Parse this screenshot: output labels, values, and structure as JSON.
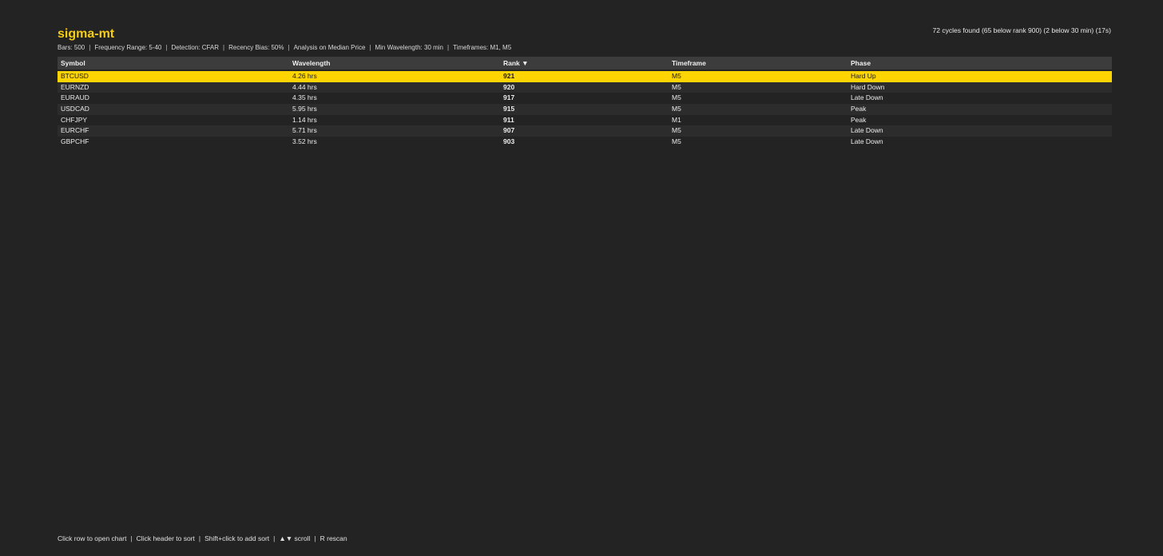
{
  "app": {
    "title": "sigma-mt",
    "summary": "72 cycles found (65 below rank 900) (2 below 30 min) (17s)"
  },
  "settings": [
    "Bars: 500",
    "Frequency Range: 5-40",
    "Detection: CFAR",
    "Recency Bias: 50%",
    "Analysis on Median Price",
    "Min Wavelength: 30 min",
    "Timeframes: M1, M5"
  ],
  "table": {
    "columns": {
      "symbol": "Symbol",
      "wavelength": "Wavelength",
      "rank": "Rank ▼",
      "timeframe": "Timeframe",
      "phase": "Phase"
    },
    "selected_index": 0,
    "rows": [
      {
        "symbol": "BTCUSD",
        "wavelength": "4.26 hrs",
        "rank": "921",
        "timeframe": "M5",
        "phase": "Hard Up"
      },
      {
        "symbol": "EURNZD",
        "wavelength": "4.44 hrs",
        "rank": "920",
        "timeframe": "M5",
        "phase": "Hard Down"
      },
      {
        "symbol": "EURAUD",
        "wavelength": "4.35 hrs",
        "rank": "917",
        "timeframe": "M5",
        "phase": "Late Down"
      },
      {
        "symbol": "USDCAD",
        "wavelength": "5.95 hrs",
        "rank": "915",
        "timeframe": "M5",
        "phase": "Peak"
      },
      {
        "symbol": "CHFJPY",
        "wavelength": "1.14 hrs",
        "rank": "911",
        "timeframe": "M1",
        "phase": "Peak"
      },
      {
        "symbol": "EURCHF",
        "wavelength": "5.71 hrs",
        "rank": "907",
        "timeframe": "M5",
        "phase": "Late Down"
      },
      {
        "symbol": "GBPCHF",
        "wavelength": "3.52 hrs",
        "rank": "903",
        "timeframe": "M5",
        "phase": "Late Down"
      }
    ]
  },
  "footer": [
    "Click row to open chart",
    "Click header to sort",
    "Shift+click to add sort",
    "▲▼ scroll",
    "R rescan"
  ],
  "colors": {
    "background": "#232323",
    "accent": "#f5cc16",
    "selected_row": "#fed501",
    "header_row": "#3c3c3c"
  }
}
